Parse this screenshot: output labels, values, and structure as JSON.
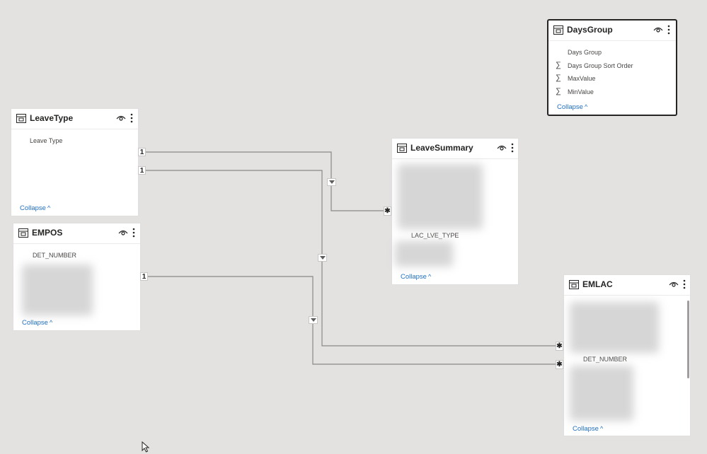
{
  "tables": {
    "leavetype": {
      "title": "LeaveType",
      "fields": [
        "Leave Type"
      ],
      "collapse": "Collapse"
    },
    "empos": {
      "title": "EMPOS",
      "fields": [
        "DET_NUMBER"
      ],
      "collapse": "Collapse"
    },
    "leavesummary": {
      "title": "LeaveSummary",
      "fields": [
        "LAC_LVE_TYPE"
      ],
      "collapse": "Collapse"
    },
    "daysgroup": {
      "title": "DaysGroup",
      "fields": [
        "Days Group",
        "Days Group Sort Order",
        "MaxValue",
        "MinValue"
      ],
      "field_icons": [
        "",
        "sigma-icon",
        "sigma-icon",
        "sigma-icon"
      ],
      "collapse": "Collapse"
    },
    "emlac": {
      "title": "EMLAC",
      "fields": [
        "DET_NUMBER"
      ],
      "collapse": "Collapse"
    }
  },
  "cardinality": {
    "one": "1",
    "many": "✱"
  },
  "icons": {
    "table": "table-icon",
    "visibility": "eye-icon",
    "more": "more-options-icon",
    "filter_direction": "filter-direction-icon",
    "collapse": "chevron-up-icon"
  },
  "colors": {
    "canvas": "#e4e2e1",
    "link": "#1f6fbf",
    "relationship_line": "#8a8886"
  }
}
